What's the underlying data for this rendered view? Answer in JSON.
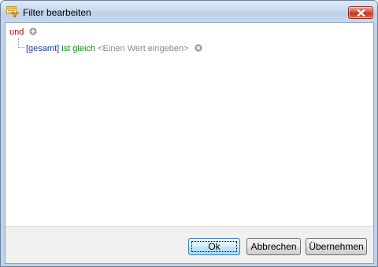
{
  "window": {
    "title": "Filter bearbeiten",
    "icon": "filter-edit-icon",
    "close_icon": "close-icon"
  },
  "filter": {
    "root_operator": "und",
    "root_action_icon": "add-circle-icon",
    "conditions": [
      {
        "field": "[gesamt]",
        "operator": "ist gleich",
        "value_placeholder": "<Einen Wert eingeben>",
        "remove_icon": "remove-circle-icon"
      }
    ]
  },
  "buttons": {
    "ok": "Ok",
    "cancel": "Abbrechen",
    "apply": "Übernehmen"
  },
  "colors": {
    "operator": "#b00000",
    "field": "#1a3a9e",
    "condition": "#148a14",
    "placeholder": "#888888"
  }
}
